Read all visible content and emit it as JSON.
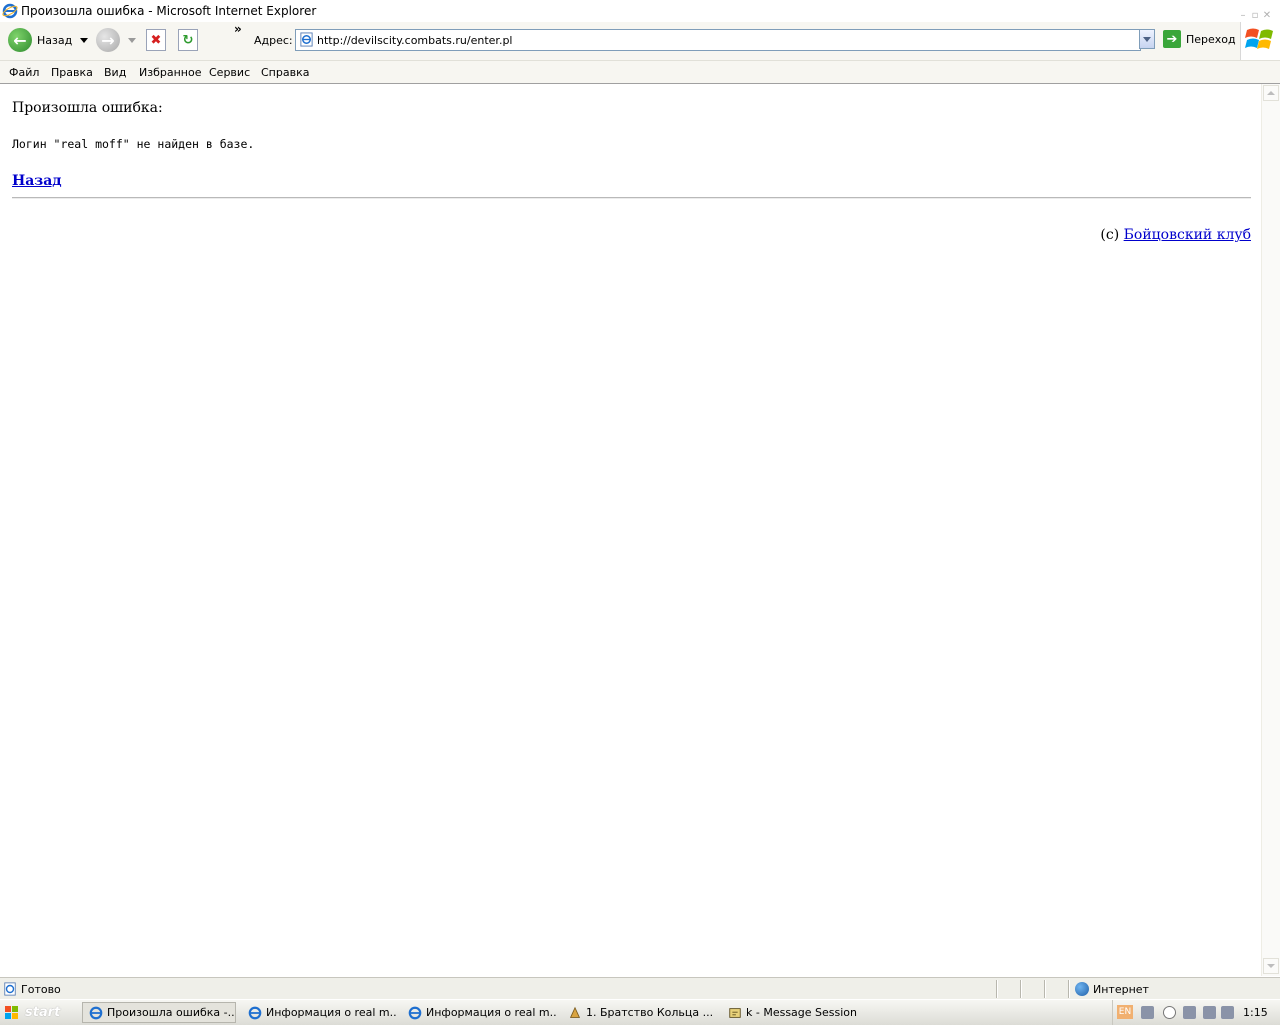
{
  "window": {
    "title": "Произошла ошибка - Microsoft Internet Explorer"
  },
  "toolbar": {
    "back_label": "Назад",
    "chevron": "»",
    "address_label": "Адрес:",
    "address_url": "http://devilscity.combats.ru/enter.pl",
    "go_label": "Переход"
  },
  "menu": {
    "items": [
      "Файл",
      "Правка",
      "Вид",
      "Избранное",
      "Сервис",
      "Справка"
    ]
  },
  "page": {
    "heading": "Произошла ошибка:",
    "message": "Логин \"real moff\" не найден в базе.",
    "back_link": "Назад",
    "copyright_prefix": "(c) ",
    "copyright_link": "Бойцовский клуб"
  },
  "status": {
    "text": "Готово",
    "zone": "Интернет"
  },
  "taskbar": {
    "start_label": "start",
    "tasks": [
      "Произошла ошибка -...",
      "Информация о real m...",
      "Информация о real m...",
      "1. Братство Кольца ...",
      "k - Message Session"
    ],
    "lang": "EN",
    "clock": "1:15"
  },
  "colors": {
    "link": "#0000cc",
    "accent_green": "#2e8b2e"
  }
}
